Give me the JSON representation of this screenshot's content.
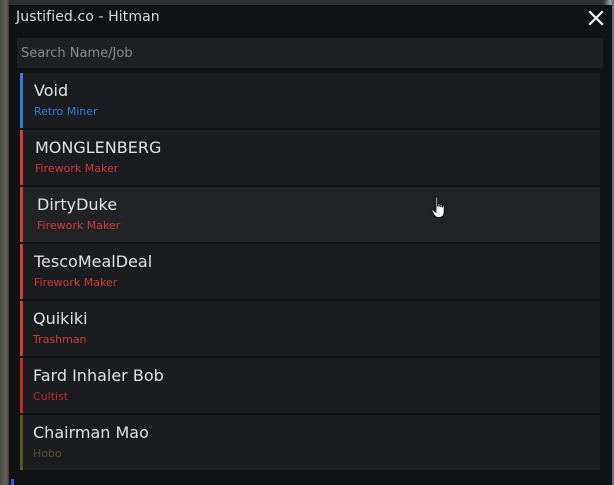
{
  "window": {
    "title": "Justified.co - Hitman"
  },
  "search": {
    "placeholder": "Search Name/Job",
    "value": ""
  },
  "players": [
    {
      "name": "Void",
      "job": "Retro Miner",
      "color": "#2f7fe0"
    },
    {
      "name": "MONGLENBERG",
      "job": "Firework Maker",
      "color": "#d23b3b"
    },
    {
      "name": "DirtyDuke",
      "job": "Firework Maker",
      "color": "#d23b3b"
    },
    {
      "name": "TescoMealDeal",
      "job": "Firework Maker",
      "color": "#d23b3b"
    },
    {
      "name": "Quikiki",
      "job": "Trashman",
      "color": "#d23b3b"
    },
    {
      "name": "Fard Inhaler Bob",
      "job": "Cultist",
      "color": "#c42a2a"
    },
    {
      "name": "Chairman Mao",
      "job": "Hobo",
      "color": "#5a5224"
    }
  ],
  "icons": {
    "close": "close-icon",
    "cursor": "hand-pointer-icon"
  }
}
